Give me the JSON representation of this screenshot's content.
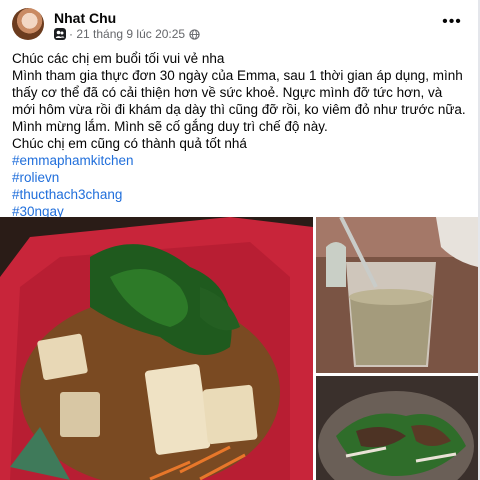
{
  "post": {
    "author": "Nhat Chu",
    "timestamp": "21 tháng 9 lúc 20:25",
    "more_label": "•••",
    "text_lines": [
      "Chúc các chị em buổi tối vui vẻ nha",
      "Mình tham gia thực đơn 30 ngày của Emma, sau 1 thời gian áp dụng, mình thấy cơ thể đã có cải thiện hơn về sức khoẻ. Ngực mình đỡ tức hơn, và mới hôm vừa rồi đi khám dạ dày thì cũng đỡ rồi, ko viêm đỏ như trước nữa. Mình mừng lắm. Mình sẽ cố gắng duy trì chế độ này.",
      "Chúc chị em cũng có thành quả tốt nhá"
    ],
    "hashtags": [
      "#emmaphamkitchen",
      "#rolievn",
      "#thucthach3chang",
      "#30ngay"
    ]
  },
  "icons": {
    "audience": "group-audience-icon",
    "privacy": "globe-icon",
    "more": "more-options-icon"
  },
  "colors": {
    "link": "#216fdb",
    "meta_text": "#65676b"
  }
}
